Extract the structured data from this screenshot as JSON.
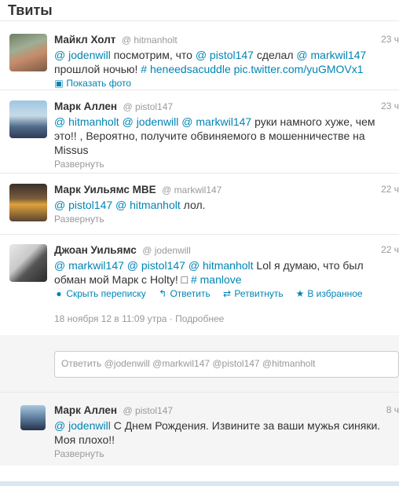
{
  "stream": {
    "title": "Твиты"
  },
  "tweets": [
    {
      "fullname": "Майкл Холт",
      "username": "@ hitmanholt",
      "time": "23 ч",
      "t": [
        {
          "k": "m",
          "v": "@ jodenwill"
        },
        {
          "k": "x",
          "v": " посмотрим, что "
        },
        {
          "k": "m",
          "v": "@ pistol147"
        },
        {
          "k": "x",
          "v": " сделал "
        },
        {
          "k": "m",
          "v": "@ markwil147"
        },
        {
          "k": "x",
          "v": " прошлой ночью! "
        },
        {
          "k": "h",
          "v": "# heneedsacuddle"
        },
        {
          "k": "x",
          "v": " "
        },
        {
          "k": "l",
          "v": "pic.twitter.com/yuGMOVx1"
        }
      ],
      "action": "Показать фото",
      "action_icon": "photo-icon"
    },
    {
      "fullname": "Марк Аллен",
      "username": "@ pistol147",
      "time": "23 ч",
      "t": [
        {
          "k": "m",
          "v": "@ hitmanholt"
        },
        {
          "k": "x",
          "v": " "
        },
        {
          "k": "m",
          "v": "@ jodenwill"
        },
        {
          "k": "x",
          "v": " "
        },
        {
          "k": "m",
          "v": "@ markwil147"
        },
        {
          "k": "x",
          "v": " руки намного хуже, чем это!! , Вероятно, получите обвиняемого в мошенничестве на Missus"
        }
      ],
      "action": "Развернуть"
    },
    {
      "fullname": "Марк Уильямс MBE",
      "username": "@ markwil147",
      "time": "22 ч",
      "t": [
        {
          "k": "m",
          "v": "@ pistol147"
        },
        {
          "k": "x",
          "v": " "
        },
        {
          "k": "m",
          "v": "@ hitmanholt"
        },
        {
          "k": "x",
          "v": " лол."
        }
      ],
      "action": "Развернуть"
    }
  ],
  "expanded": {
    "fullname": "Джоан Уильямс",
    "username": "@ jodenwill",
    "time": "22 ч",
    "t": [
      {
        "k": "m",
        "v": "@ markwil147"
      },
      {
        "k": "x",
        "v": " "
      },
      {
        "k": "m",
        "v": "@ pistol147"
      },
      {
        "k": "x",
        "v": " "
      },
      {
        "k": "m",
        "v": "@ hitmanholt"
      },
      {
        "k": "x",
        "v": " Lol я думаю, что был обман мой Марк с Holty! □ "
      },
      {
        "k": "h",
        "v": "# manlove"
      }
    ],
    "actions": {
      "hide": "Скрыть переписку",
      "reply": "Ответить",
      "retweet": "Ретвитнуть",
      "favorite": "В избранное"
    },
    "date": "18 ноября 12 в 11:09 утра · Подробнее",
    "reply_placeholder": "Ответить @jodenwill @markwil147 @pistol147 @hitmanholt"
  },
  "reply": {
    "fullname": "Марк Аллен",
    "username": "@ pistol147",
    "time": "8 ч",
    "t": [
      {
        "k": "m",
        "v": "@ jodenwill"
      },
      {
        "k": "x",
        "v": " С Днем Рождения. Извините за ваши мужья синяки. Моя плохо!!"
      }
    ],
    "action": "Развернуть"
  },
  "colors": {
    "link": "#0084b4",
    "muted": "#999999",
    "text": "#333333"
  }
}
